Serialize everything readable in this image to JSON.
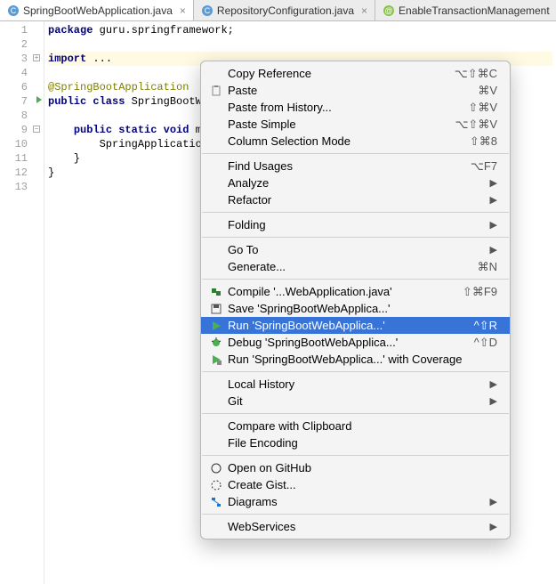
{
  "tabs": [
    {
      "label": "SpringBootWebApplication.java",
      "active": true
    },
    {
      "label": "RepositoryConfiguration.java",
      "active": false
    },
    {
      "label": "EnableTransactionManagement",
      "active": false
    }
  ],
  "lines": [
    "1",
    "2",
    "3",
    "4",
    "6",
    "7",
    "8",
    "9",
    "10",
    "11",
    "12",
    "13"
  ],
  "code": {
    "l1_kw": "package",
    "l1_rest": " guru.springframework;",
    "l3_kw": "import ",
    "l3_rest": "...",
    "l6": "@SpringBootApplication",
    "l7_kw1": "public class",
    "l7_rest": " SpringBootW",
    "l9_pad": "    ",
    "l9_kw": "public static void",
    "l9_rest": " m",
    "l10": "        SpringApplicatio",
    "l11": "    }",
    "l12": "}"
  },
  "menu": {
    "copy_ref": "Copy Reference",
    "copy_ref_sc": "⌥⇧⌘C",
    "paste": "Paste",
    "paste_sc": "⌘V",
    "paste_hist": "Paste from History...",
    "paste_hist_sc": "⇧⌘V",
    "paste_simple": "Paste Simple",
    "paste_simple_sc": "⌥⇧⌘V",
    "col_sel": "Column Selection Mode",
    "col_sel_sc": "⇧⌘8",
    "find_usages": "Find Usages",
    "find_usages_sc": "⌥F7",
    "analyze": "Analyze",
    "refactor": "Refactor",
    "folding": "Folding",
    "goto": "Go To",
    "generate": "Generate...",
    "generate_sc": "⌘N",
    "compile": "Compile '...WebApplication.java'",
    "compile_sc": "⇧⌘F9",
    "save": "Save 'SpringBootWebApplica...'",
    "run": "Run 'SpringBootWebApplica...'",
    "run_sc": "^⇧R",
    "debug": "Debug 'SpringBootWebApplica...'",
    "debug_sc": "^⇧D",
    "coverage": "Run 'SpringBootWebApplica...' with Coverage",
    "local_hist": "Local History",
    "git": "Git",
    "compare_clip": "Compare with Clipboard",
    "file_enc": "File Encoding",
    "github": "Open on GitHub",
    "gist": "Create Gist...",
    "diagrams": "Diagrams",
    "webservices": "WebServices"
  }
}
